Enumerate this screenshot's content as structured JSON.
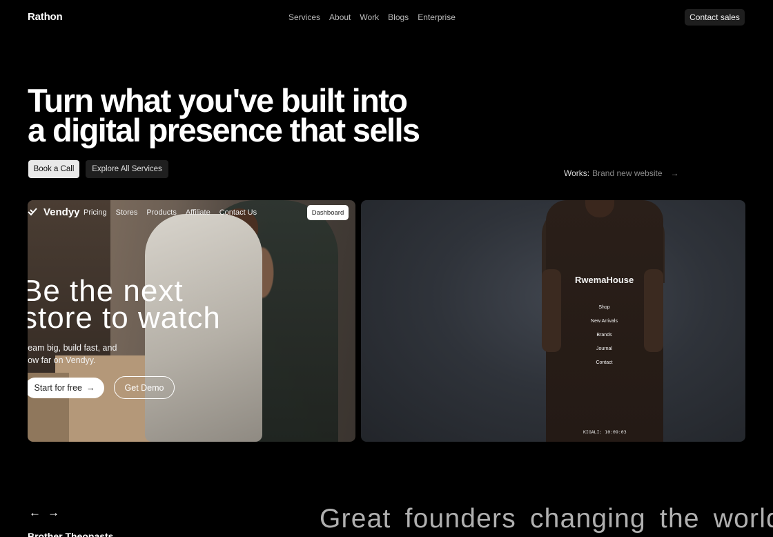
{
  "brand": "Rathon",
  "nav": [
    "Services",
    "About",
    "Work",
    "Blogs",
    "Enterprise"
  ],
  "contact_sales": "Contact sales",
  "hero": {
    "line1": "Turn what you've built into",
    "line2": "a digital presence that sells",
    "btn_primary": "Book a Call",
    "btn_secondary": "Explore All Services",
    "works_label": "Works:",
    "works_value": "Brand new website",
    "works_arrow": "→"
  },
  "card1": {
    "logo": "Vendyy",
    "nav": [
      "Pricing",
      "Stores",
      "Products",
      "Affiliate",
      "Contact Us"
    ],
    "dashboard": "Dashboard",
    "headline_1": "Be the next",
    "headline_2": "store to watch",
    "sub_1": "ream big, build fast, and",
    "sub_2": "row far on Vendyy.",
    "start": "Start for free",
    "start_arrow": "→",
    "demo": "Get Demo"
  },
  "card2": {
    "title": "RwemaHouse",
    "menu": [
      "Shop",
      "New Arrivals",
      "Brands",
      "Journal",
      "Contact"
    ],
    "clock": "KIGALI: 10:09:03"
  },
  "bottom": {
    "prev": "←",
    "next": "→",
    "left_title": "Brother Theopasts",
    "headline": "Great founders changing the world"
  },
  "colors": {
    "background": "#000000",
    "text": "#ffffff",
    "muted": "#8a8a8a"
  }
}
